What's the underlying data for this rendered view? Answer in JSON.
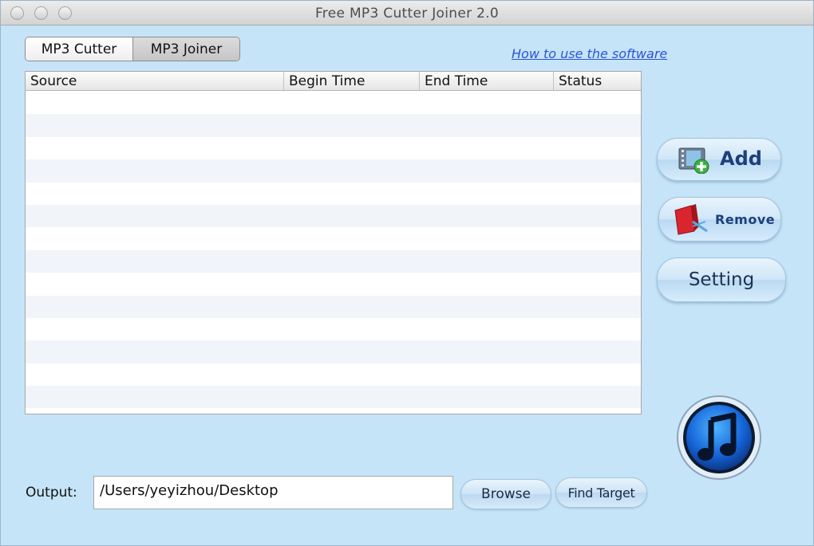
{
  "window": {
    "title": "Free MP3 Cutter Joiner 2.0"
  },
  "tabs": [
    {
      "label": "MP3 Cutter",
      "active": true
    },
    {
      "label": "MP3 Joiner",
      "active": false
    }
  ],
  "help_link": "How to use the software",
  "table": {
    "columns": [
      "Source",
      "Begin Time",
      "End Time",
      "Status"
    ],
    "rows": []
  },
  "actions": {
    "add_label": "Add",
    "remove_label": "Remove",
    "setting_label": "Setting"
  },
  "output": {
    "label": "Output:",
    "path": "/Users/yeyizhou/Desktop",
    "browse_label": "Browse",
    "find_target_label": "Find Target"
  },
  "icons": {
    "add": "film-add-icon",
    "remove": "remove-icon",
    "logo": "music-note-icon"
  },
  "colors": {
    "background": "#c6e4f7",
    "link": "#2a55d9",
    "button_text": "#1e3f7a"
  }
}
